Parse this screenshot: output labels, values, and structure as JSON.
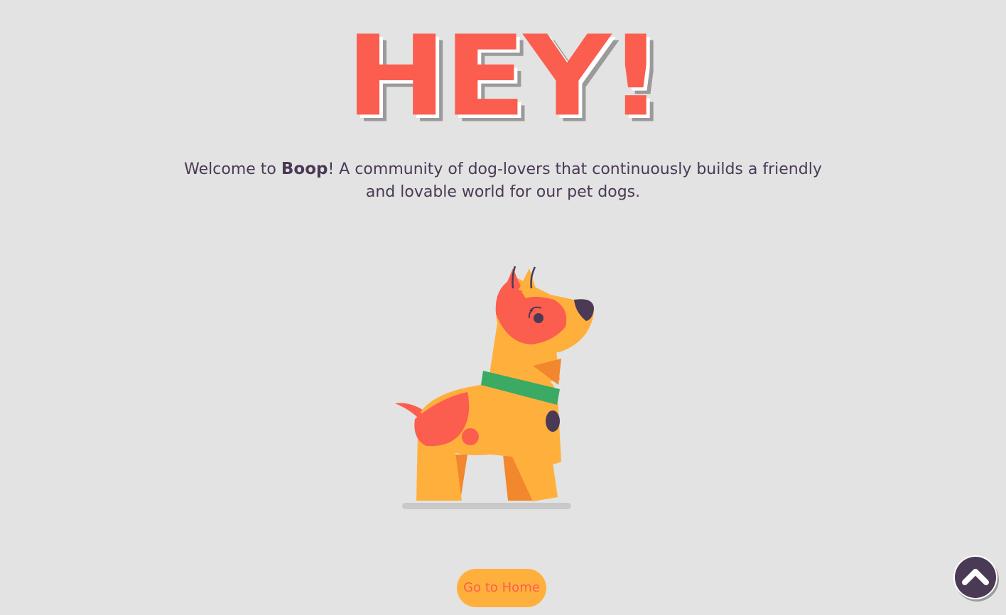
{
  "hero": {
    "title": "HEY!"
  },
  "welcome": {
    "prefix": "Welcome to ",
    "brand": "Boop",
    "suffix": "! A community of dog-lovers that continuously builds a friendly and lovable world for our pet dogs."
  },
  "illustration": {
    "icon": "dog-illustration",
    "colors": {
      "body": "#ffb03c",
      "patch": "#fb5d4f",
      "collar": "#3aaa64",
      "dark": "#4a3a55",
      "shade": "#f2872d"
    }
  },
  "actions": {
    "home_label": "Go to Home",
    "scroll_top_icon": "chevron-up-icon"
  },
  "colors": {
    "background": "#e3e3e3",
    "accent": "#fb5d4f",
    "button": "#ffb03c",
    "text": "#4a3a55"
  }
}
